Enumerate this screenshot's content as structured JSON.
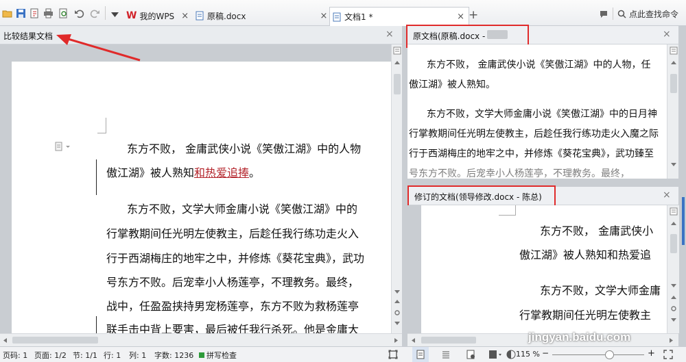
{
  "tabs": [
    {
      "label": "我的WPS",
      "close": "×"
    },
    {
      "label": "原稿.docx",
      "close": "×"
    },
    {
      "label": "文档1 *",
      "close": "×"
    }
  ],
  "new_tab": "+",
  "search_label": "点此查找命令",
  "left_panel": {
    "title": "比较结果文档",
    "close": "×",
    "para1_line1": "东方不败，  金庸武侠小说《笑傲江湖》中的人物",
    "para1_line2_a": "傲江湖》被人熟知",
    "para1_line2_ins": "和热爱追捧",
    "para1_line2_end": "。",
    "para2_lines": [
      "东方不败，文学大师金庸小说《笑傲江湖》中的",
      "行掌教期间任光明左使教主，后趁任我行练功走火入",
      "行于西湖梅庄的地牢之中，并修炼《葵花宝典》，武功",
      "号东方不败。后宠幸小人杨莲亭，不理教务。最终，",
      "战中，任盈盈挟持男宠杨莲亭，东方不败为救杨莲亭",
      "联手击中背上要害，最后被任我行杀死。他是金庸大"
    ]
  },
  "original_panel": {
    "title": "原文档(原稿.docx - ",
    "close": "×",
    "lines": [
      "东方不败，  金庸武侠小说《笑傲江湖》中的人物，任",
      "傲江湖》被人熟知。",
      "东方不败，文学大师金庸小说《笑傲江湖》中的日月神",
      "行掌教期间任光明左使教主，后趁任我行练功走火入魔之际",
      "行于西湖梅庄的地牢之中，并修炼《葵花宝典》，武功臻至",
      "号东方不败。后宠幸小人杨莲亭，不理教务。最终，"
    ]
  },
  "revised_panel": {
    "title": "修订的文档(领导修改.docx - 陈总)",
    "close": "×",
    "lines": [
      "东方不败，  金庸武侠小",
      "傲江湖》被人熟知和热爱追",
      "东方不败，文学大师金庸",
      "行掌教期间任光明左使教主"
    ]
  },
  "status": {
    "page_code": "页码: 1",
    "page": "页面: 1/2",
    "section": "节: 1/1",
    "row": "行: 1",
    "col": "列: 1",
    "word_count": "字数: 1236",
    "spell_check": "拼写检查",
    "zoom": "115 %",
    "zoom_level": 0.62
  },
  "watermark": "jingyan.baidu.com",
  "colors": {
    "insert_red": "#b3232a",
    "annotation_red": "#e02a2a"
  }
}
